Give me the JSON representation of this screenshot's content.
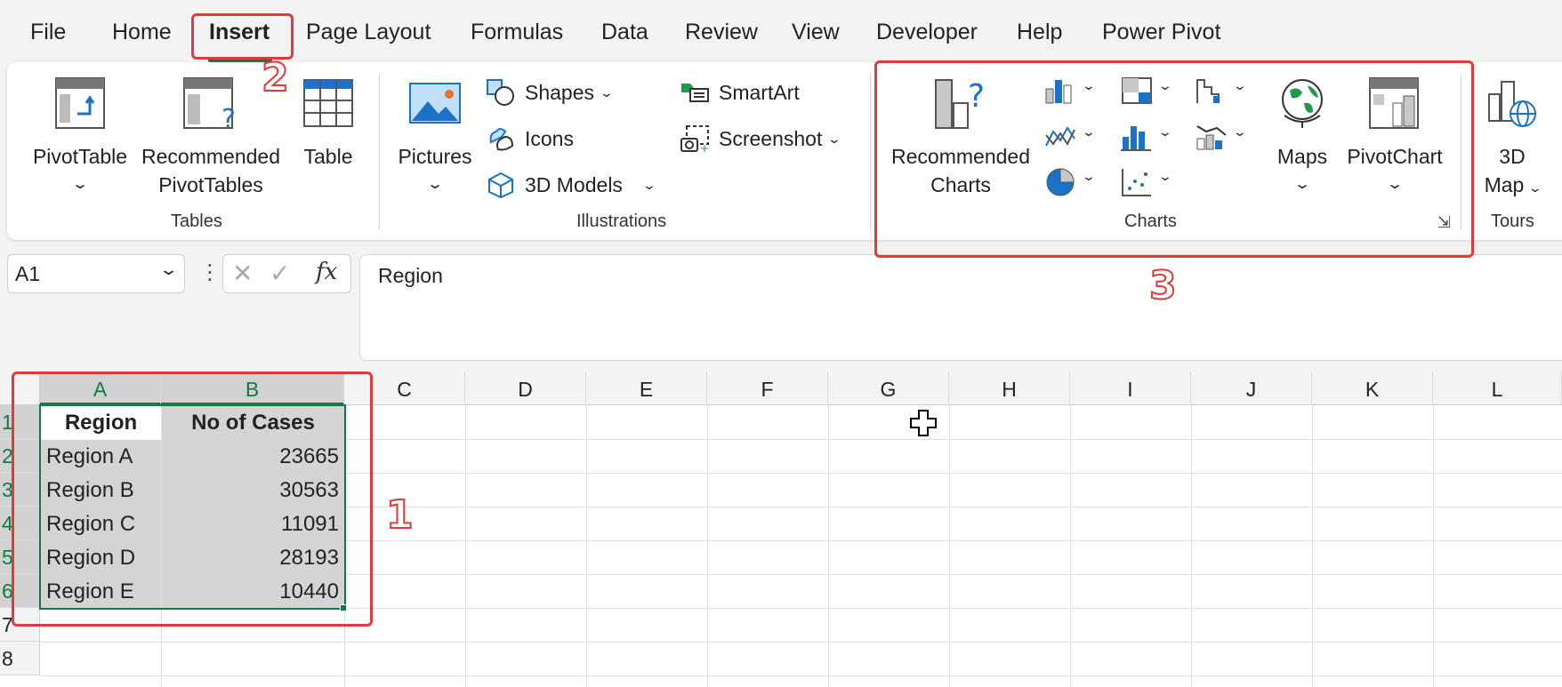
{
  "menu": {
    "tabs": [
      "File",
      "Home",
      "Insert",
      "Page Layout",
      "Formulas",
      "Data",
      "Review",
      "View",
      "Developer",
      "Help",
      "Power Pivot"
    ]
  },
  "ribbon": {
    "tables": {
      "pivottable": "PivotTable",
      "recommended_line1": "Recommended",
      "recommended_line2": "PivotTables",
      "table": "Table",
      "group_label": "Tables"
    },
    "illustrations": {
      "pictures": "Pictures",
      "shapes": "Shapes",
      "icons": "Icons",
      "models3d": "3D Models",
      "smartart": "SmartArt",
      "screenshot": "Screenshot",
      "group_label": "Illustrations"
    },
    "charts": {
      "recommended_line1": "Recommended",
      "recommended_line2": "Charts",
      "maps": "Maps",
      "pivotchart": "PivotChart",
      "group_label": "Charts"
    },
    "tours": {
      "map_line1": "3D",
      "map_line2": "Map",
      "group_label": "Tours"
    }
  },
  "formula_bar": {
    "name_box": "A1",
    "fx_label": "fx",
    "value": "Region"
  },
  "sheet": {
    "columns": [
      "A",
      "B",
      "C",
      "D",
      "E",
      "F",
      "G",
      "H",
      "I",
      "J",
      "K",
      "L"
    ],
    "rows": [
      "1",
      "2",
      "3",
      "4",
      "5",
      "6",
      "7",
      "8"
    ],
    "headers": [
      "Region",
      "No of Cases"
    ],
    "data": [
      {
        "region": "Region A",
        "cases": "23665"
      },
      {
        "region": "Region B",
        "cases": "30563"
      },
      {
        "region": "Region C",
        "cases": "11091"
      },
      {
        "region": "Region D",
        "cases": "28193"
      },
      {
        "region": "Region E",
        "cases": "10440"
      }
    ]
  },
  "annotations": {
    "step1": "1",
    "step2": "2",
    "step3": "3"
  },
  "colors": {
    "accent_green": "#107c41",
    "annotation_red": "#e03a3a",
    "selection_gray": "#d4d4d4"
  }
}
